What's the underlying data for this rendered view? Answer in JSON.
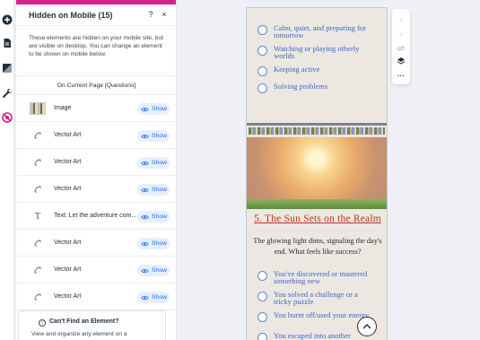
{
  "rail": {
    "items": [
      {
        "name": "add-icon"
      },
      {
        "name": "pages-icon"
      },
      {
        "name": "design-icon"
      },
      {
        "name": "tools-icon"
      },
      {
        "name": "hidden-elements-icon",
        "active": true
      }
    ]
  },
  "panel": {
    "title": "Hidden on Mobile (15)",
    "help_label": "?",
    "close_label": "×",
    "description": "These elements are hidden on your mobile site, but are visible on desktop. You can change an element to be shown on mobile below.",
    "section_label": "On Current Page [Questions]",
    "show_label": "Show",
    "items": [
      {
        "label": "Image",
        "icon": "image-thumbnail"
      },
      {
        "label": "Vector Art",
        "icon": "vector-art-icon"
      },
      {
        "label": "Vector Art",
        "icon": "vector-art-icon"
      },
      {
        "label": "Vector Art",
        "icon": "vector-art-icon"
      },
      {
        "label": "Text: Let the adventure com...",
        "icon": "text-icon"
      },
      {
        "label": "Vector Art",
        "icon": "vector-art-icon"
      },
      {
        "label": "Vector Art",
        "icon": "vector-art-icon"
      },
      {
        "label": "Vector Art",
        "icon": "vector-art-icon"
      }
    ],
    "cant_find": {
      "title": "Can't Find an Element?",
      "description": "View and organize any element on a"
    }
  },
  "mobile": {
    "top_options": [
      "Calm, quiet, and preparing for tomorrow",
      "Watching or playing otherly worlds",
      "Keeping active",
      "Solving problems"
    ],
    "heading": "5. The Sun Sets on the Realm",
    "body": "The glowing light dims, signaling the day's end. What feels like success?",
    "bottom_options": [
      "You've discovered or mastered something new",
      "You solved a challenge or a tricky puzzle",
      "You burnt off/used your energy",
      "You escaped into another"
    ]
  },
  "colors": {
    "accent": "#d6228a",
    "link_blue": "#116dff",
    "option_blue": "#3b68c9",
    "heading_red": "#b53a1e"
  }
}
